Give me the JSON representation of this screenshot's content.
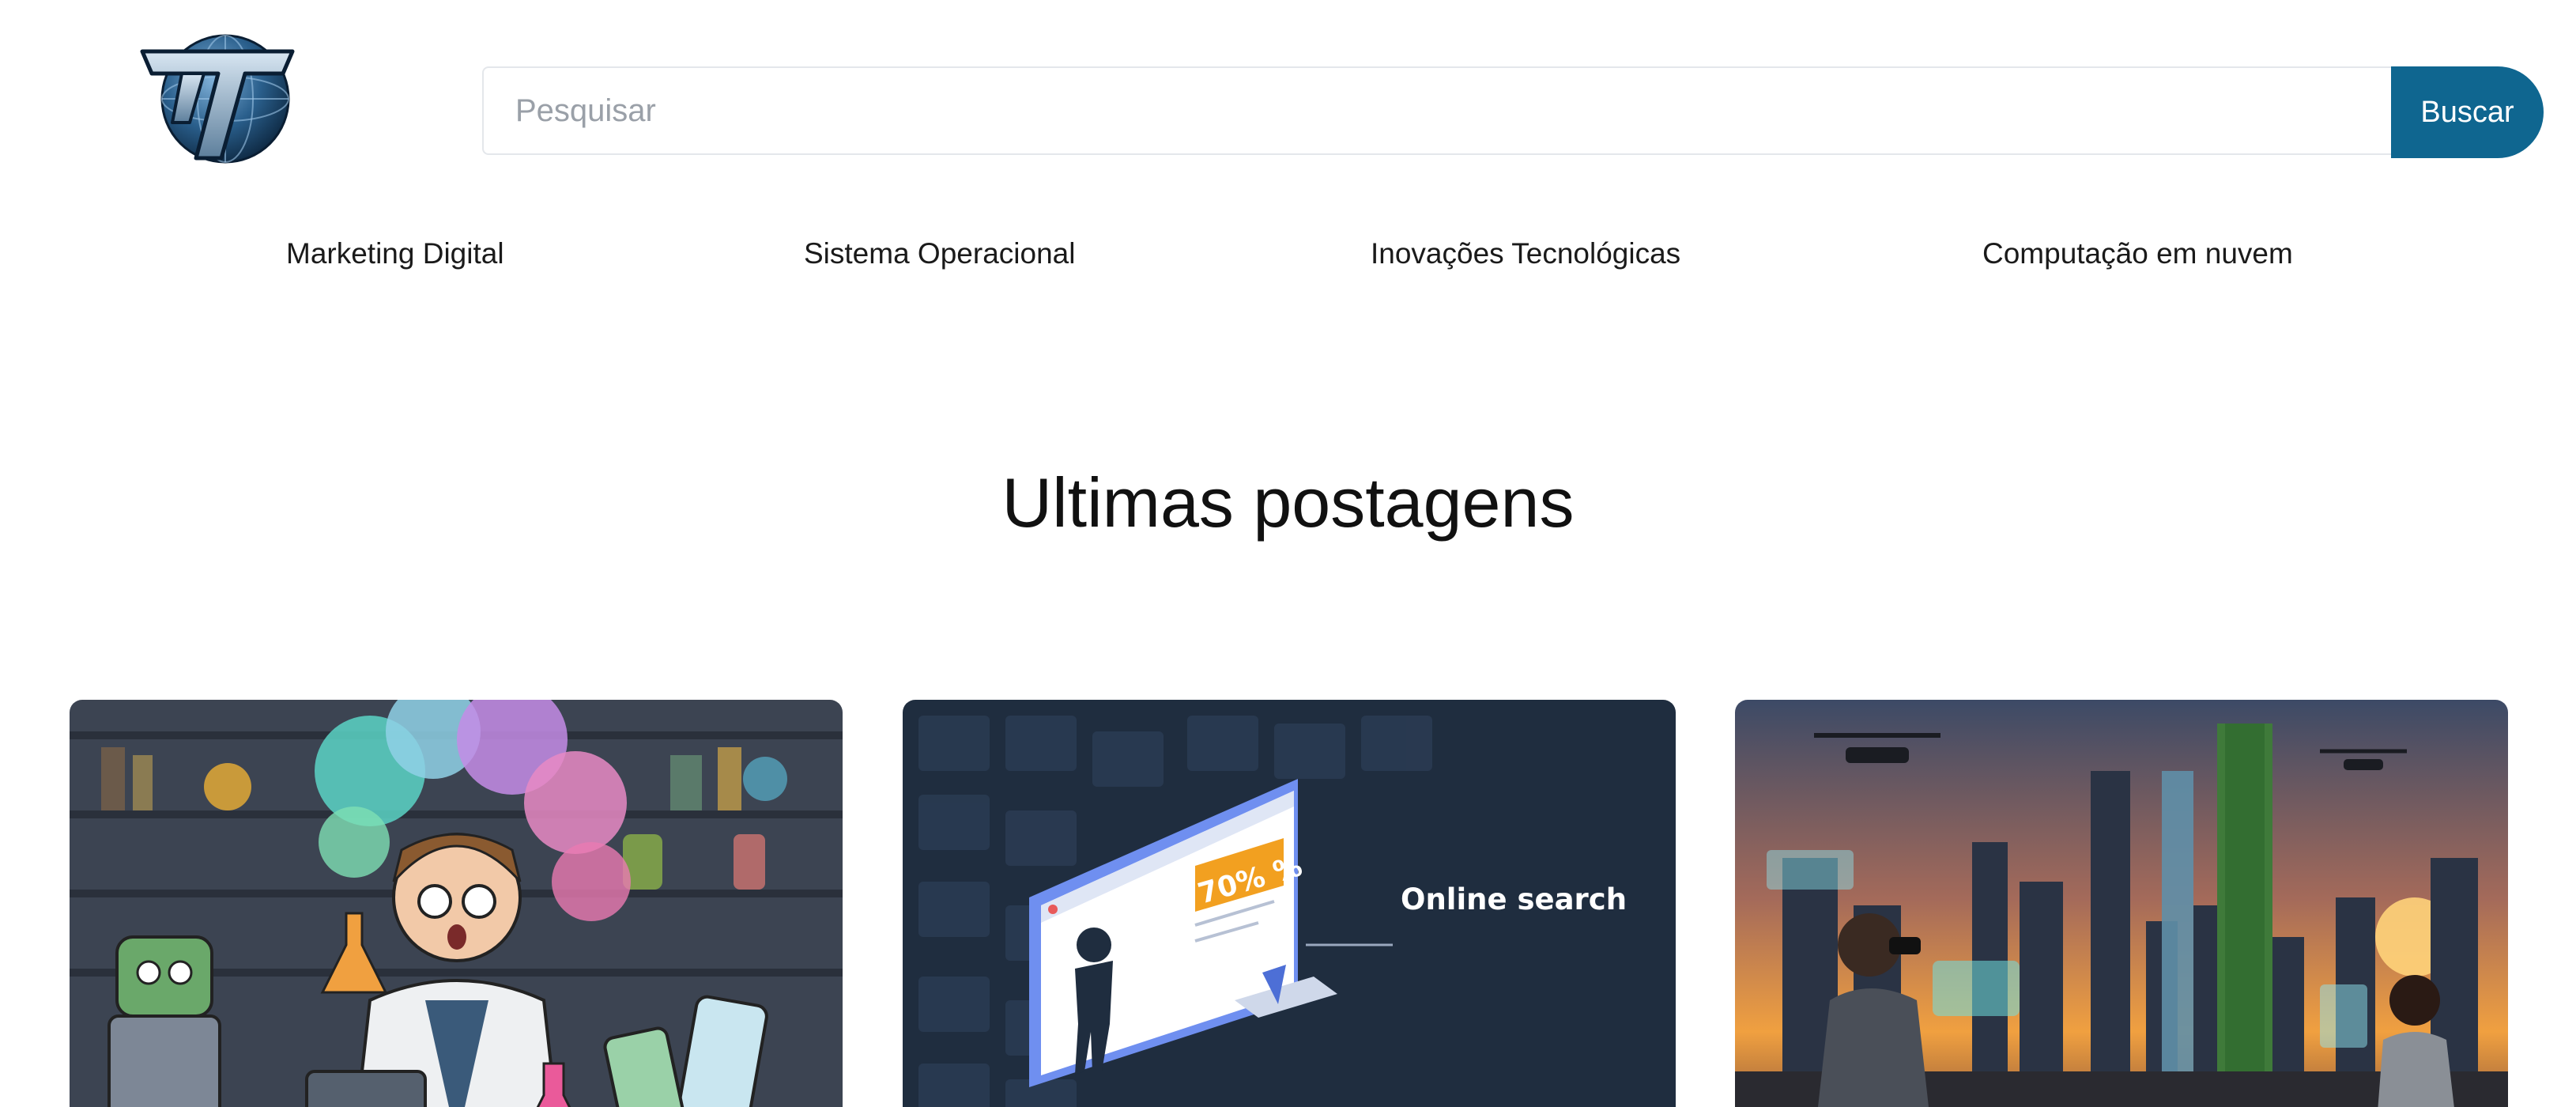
{
  "header": {
    "logo_icon": "globe-t-logo-icon",
    "search": {
      "placeholder": "Pesquisar",
      "value": ""
    },
    "search_button_label": "Buscar",
    "accent_color": "#0f6690"
  },
  "nav": {
    "items": [
      {
        "label": "Marketing Digital"
      },
      {
        "label": "Sistema Operacional"
      },
      {
        "label": "Inovações Tecnológicas"
      },
      {
        "label": "Computação em nuvem"
      }
    ]
  },
  "main": {
    "section_title": "Ultimas postagens",
    "posts": [
      {
        "image": "scientist-lab-illustration-image"
      },
      {
        "image": "online-search-illustration-image",
        "image_text": {
          "badge": "70% %",
          "caption": "Online search"
        }
      },
      {
        "image": "futuristic-city-drones-image"
      }
    ]
  }
}
